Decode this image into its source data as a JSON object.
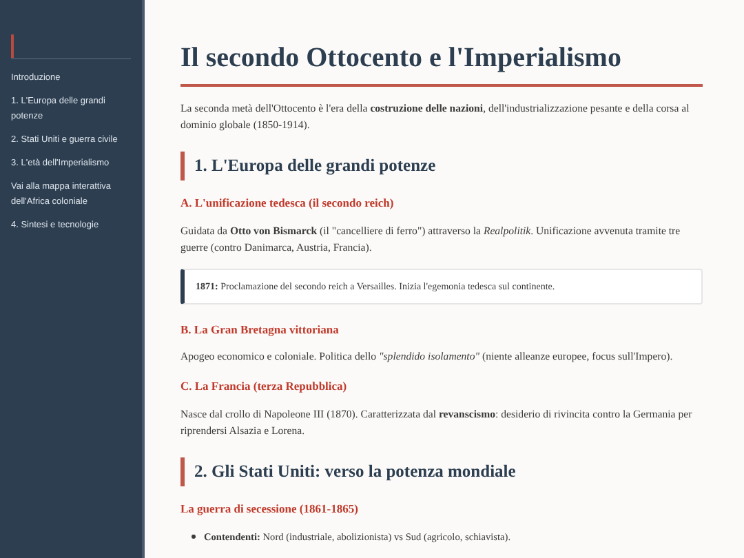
{
  "sidebar": {
    "items": [
      {
        "label": "Introduzione"
      },
      {
        "label": "1. L'Europa delle grandi potenze"
      },
      {
        "label": "2. Stati Uniti e guerra civile"
      },
      {
        "label": "3. L'età dell'Imperialismo"
      },
      {
        "label": "Vai alla mappa interattiva dell'Africa coloniale"
      },
      {
        "label": "4. Sintesi e tecnologie"
      }
    ]
  },
  "title": "Il secondo Ottocento e l'Imperialismo",
  "blocks": [
    {
      "kind": "paragraph",
      "text": "La seconda metà dell'Ottocento è l'era della **costruzione delle nazioni**, dell'industrializzazione pesante e della corsa al dominio globale (1850-1914)."
    },
    {
      "kind": "section",
      "text": "1. L'Europa delle grandi potenze"
    },
    {
      "kind": "subsection",
      "text": "A. L'unificazione tedesca (il secondo reich)"
    },
    {
      "kind": "paragraph",
      "text": "Guidata da **Otto von Bismarck** (il \"cancelliere di ferro\") attraverso la *Realpolitik*. Unificazione avvenuta tramite tre guerre (contro Danimarca, Austria, Francia)."
    },
    {
      "kind": "note",
      "text": "**1871:** Proclamazione del secondo reich a Versailles. Inizia l'egemonia tedesca sul continente."
    },
    {
      "kind": "subsection",
      "text": "B. La Gran Bretagna vittoriana"
    },
    {
      "kind": "paragraph",
      "text": "Apogeo economico e coloniale. Politica dello *\"splendido isolamento\"* (niente alleanze europee, focus sull'Impero)."
    },
    {
      "kind": "subsection",
      "text": "C. La Francia (terza Repubblica)"
    },
    {
      "kind": "paragraph",
      "text": "Nasce dal crollo di Napoleone III (1870). Caratterizzata dal **revanscismo**: desiderio di rivincita contro la Germania per riprendersi Alsazia e Lorena."
    },
    {
      "kind": "section",
      "text": "2. Gli Stati Uniti: verso la potenza mondiale"
    },
    {
      "kind": "subsection",
      "text": "La guerra di secessione (1861-1865)"
    },
    {
      "kind": "bullets",
      "items": [
        "**Contendenti:** Nord (industriale, abolizionista) vs Sud (agricolo, schiavista)."
      ]
    }
  ]
}
